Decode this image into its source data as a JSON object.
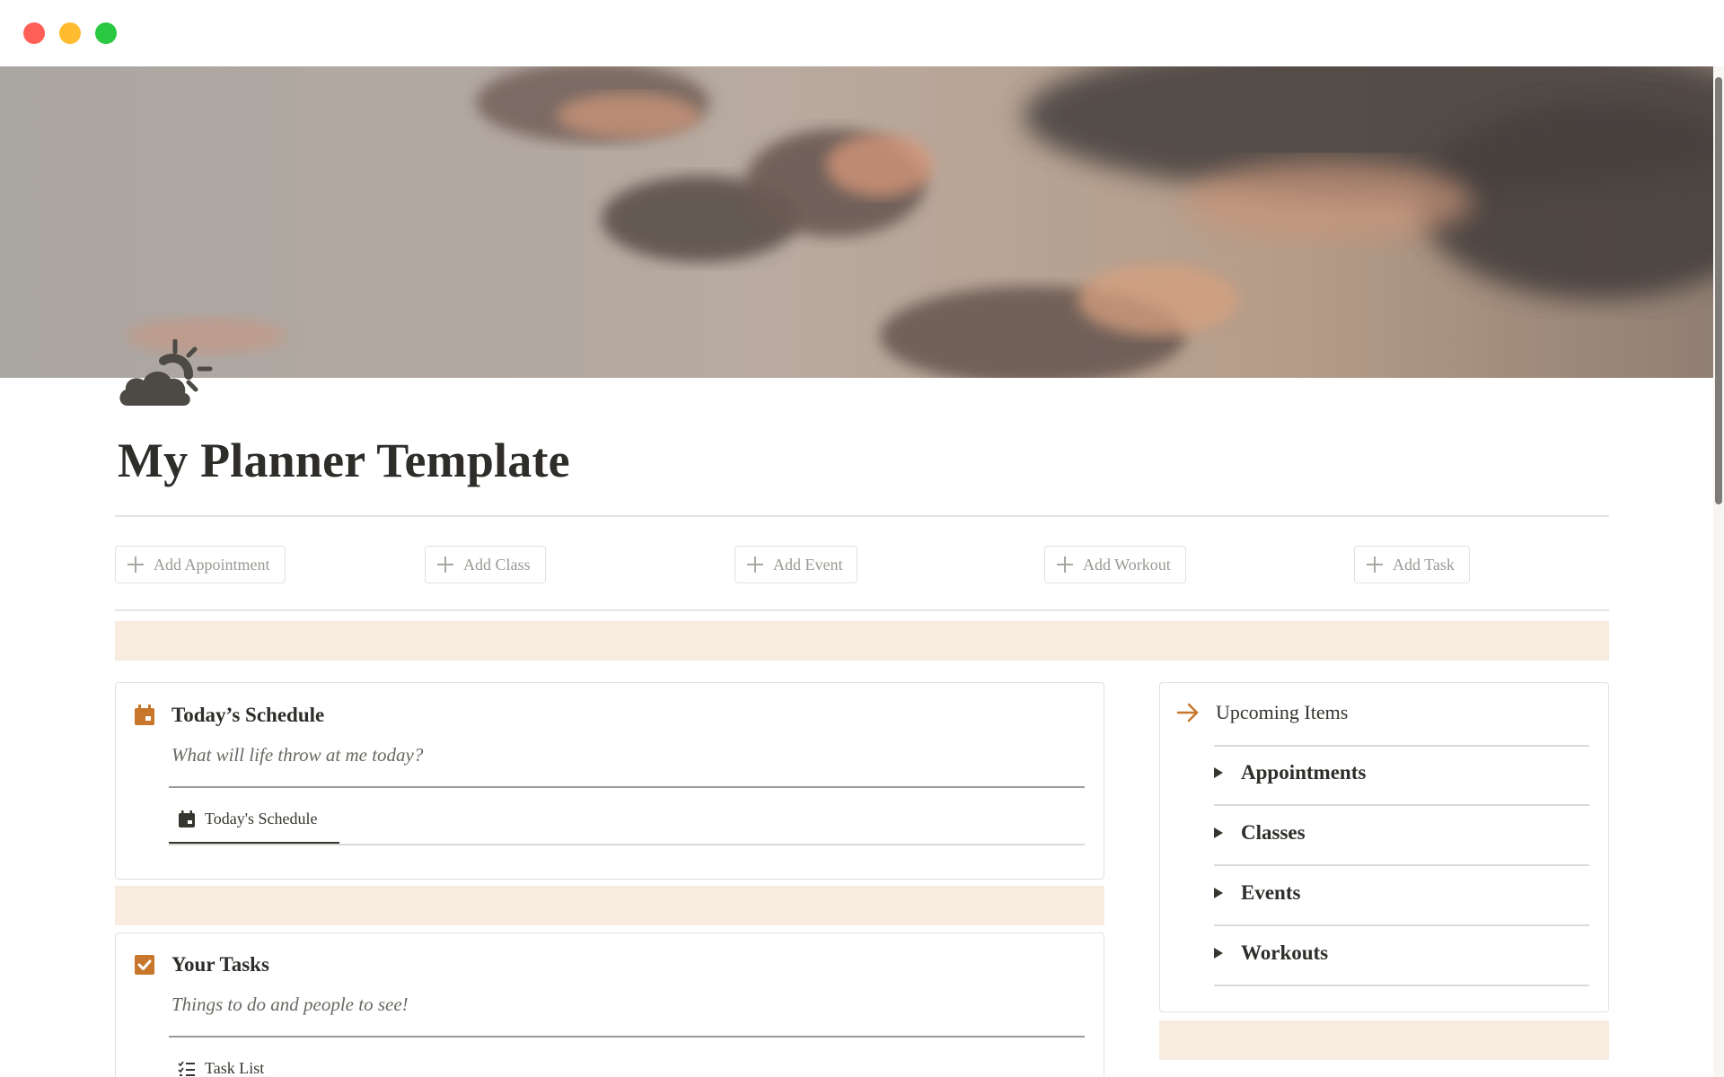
{
  "window": {
    "controls": [
      "close",
      "minimize",
      "zoom"
    ]
  },
  "page": {
    "icon": "sun-behind-cloud-icon",
    "title": "My Planner Template"
  },
  "quick_add": [
    {
      "label": "Add Appointment",
      "icon": "plus-icon"
    },
    {
      "label": "Add Class",
      "icon": "plus-icon"
    },
    {
      "label": "Add Event",
      "icon": "plus-icon"
    },
    {
      "label": "Add Workout",
      "icon": "plus-icon"
    },
    {
      "label": "Add Task",
      "icon": "plus-icon"
    }
  ],
  "schedule": {
    "icon": "calendar-icon",
    "title": "Today’s Schedule",
    "subtitle": "What will life throw at me today?",
    "view_tab": {
      "icon": "calendar-icon",
      "label": "Today's Schedule"
    }
  },
  "tasks": {
    "icon": "checkbox-icon",
    "title": "Your Tasks",
    "subtitle": "Things to do and people to see!",
    "view_tab": {
      "icon": "checklist-icon",
      "label": "Task List"
    }
  },
  "upcoming": {
    "icon": "arrow-right-icon",
    "title": "Upcoming Items",
    "items": [
      {
        "label": "Appointments"
      },
      {
        "label": "Classes"
      },
      {
        "label": "Events"
      },
      {
        "label": "Workouts"
      }
    ]
  },
  "colors": {
    "accent": "#c9762d",
    "band": "#f8ebdf",
    "text": "#37352f",
    "muted": "#9b9893"
  }
}
